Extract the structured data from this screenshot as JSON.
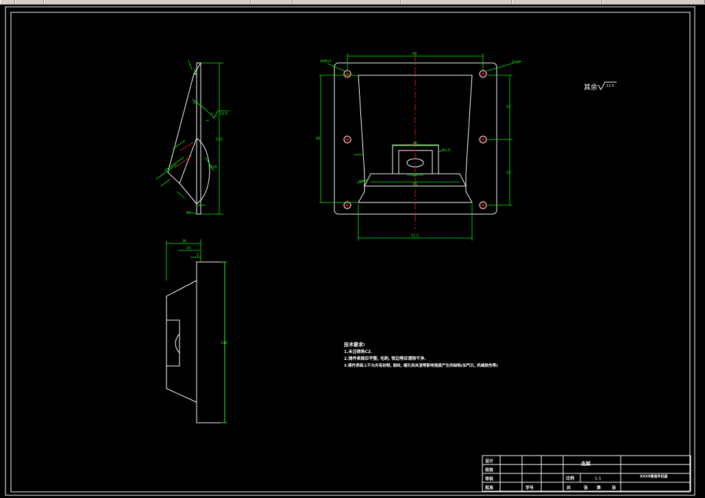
{
  "drawing": {
    "roughness_note": "其余",
    "roughness_value": "12.5",
    "notes_title": "技术要求:",
    "notes": [
      "1.未注倒角C2.",
      "2.铸件表面应平整, 毛刺, 锐边等应清除干净.",
      "3.铸件表面上不允许有砂眼, 裂纹, 缩孔和夹渣等影响强度产生的缺陷(如气孔, 机械损伤等)"
    ]
  },
  "front_view": {
    "dim_top": "96",
    "dim_left_height": "90",
    "dim_right_upper": "55",
    "dim_right_lower": "52",
    "dim_bottom": "57.5",
    "dim_slot_width": "40",
    "dim_slot_small": "12",
    "dim_slot_base": "81",
    "hole_callout_left": "4xM12",
    "hole_callout_right": "6xφ6",
    "angle_label": "20°",
    "surface_label": "12.5"
  },
  "side_view": {
    "dim_height": "120",
    "dim_depth": "40",
    "dim_radius": "R25",
    "dim_small": "15",
    "roughness": "12.5"
  },
  "bottom_view": {
    "dim_total": "30",
    "dim_mid": "10",
    "dim_small": "5",
    "dim_height": "140"
  },
  "title_block": {
    "rows": [
      "设计",
      "校核",
      "审核",
      "批准"
    ],
    "part_name": "支架",
    "scale_label": "比例",
    "scale_value": "1:1",
    "drawing_no": "XXXX铸造件机座",
    "footer": [
      "共",
      "张",
      "第",
      "张"
    ],
    "record_no": "学号"
  }
}
